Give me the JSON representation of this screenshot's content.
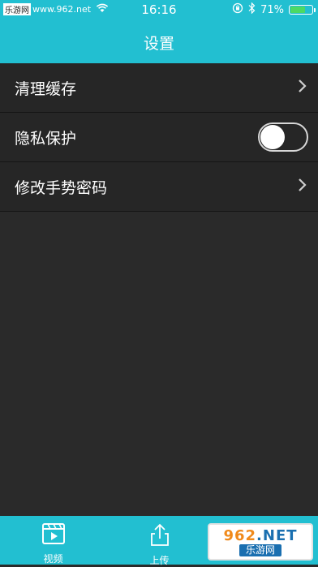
{
  "status_bar": {
    "carrier_box": "乐游网",
    "carrier_rest": "www.962.net",
    "time": "16:16",
    "battery_text": "71%",
    "battery_level": 0.71
  },
  "nav": {
    "title": "设置"
  },
  "settings": {
    "items": [
      {
        "label": "清理缓存"
      },
      {
        "label": "隐私保护",
        "toggle_on": false
      },
      {
        "label": "修改手势密码"
      }
    ]
  },
  "tabs": [
    {
      "label": "视频",
      "icon": "video-icon"
    },
    {
      "label": "上传",
      "icon": "upload-icon"
    }
  ],
  "watermark": {
    "main_num": "962",
    "main_suffix": ".NET",
    "sub": "乐游网"
  },
  "colors": {
    "accent": "#22bfd1",
    "background": "#2a2a2a",
    "row_bg": "#262626"
  }
}
